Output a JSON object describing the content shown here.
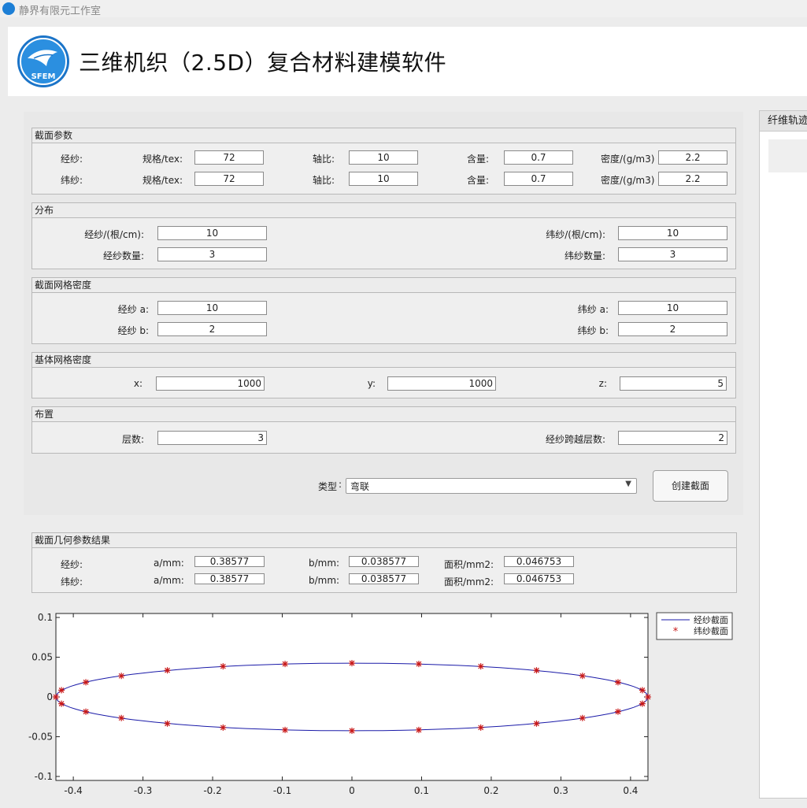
{
  "window": {
    "title": "静界有限元工作室"
  },
  "app": {
    "title": "三维机织（2.5D）复合材料建模软件",
    "logo_text": "SFEM"
  },
  "colors": {
    "accent": "#1d7fd6",
    "warp_line": "#1a1aa8",
    "weft_marker": "#c81818"
  },
  "section_params": {
    "title": "截面参数",
    "rows": [
      {
        "label": "经纱:",
        "spec_label": "规格/tex:",
        "spec": "72",
        "ratio_label": "轴比:",
        "ratio": "10",
        "content_label": "含量:",
        "content": "0.7",
        "density_label": "密度/(g/m3)",
        "density": "2.2"
      },
      {
        "label": "纬纱:",
        "spec_label": "规格/tex:",
        "spec": "72",
        "ratio_label": "轴比:",
        "ratio": "10",
        "content_label": "含量:",
        "content": "0.7",
        "density_label": "密度/(g/m3)",
        "density": "2.2"
      }
    ]
  },
  "distribution": {
    "title": "分布",
    "warp_density_label": "经纱/(根/cm):",
    "warp_density": "10",
    "weft_density_label": "纬纱/(根/cm):",
    "weft_density": "10",
    "warp_count_label": "经纱数量:",
    "warp_count": "3",
    "weft_count_label": "纬纱数量:",
    "weft_count": "3"
  },
  "section_mesh": {
    "title": "截面网格密度",
    "warp_a_label": "经纱 a:",
    "warp_a": "10",
    "warp_b_label": "经纱 b:",
    "warp_b": "2",
    "weft_a_label": "纬纱 a:",
    "weft_a": "10",
    "weft_b_label": "纬纱 b:",
    "weft_b": "2"
  },
  "matrix_mesh": {
    "title": "基体网格密度",
    "x_label": "x:",
    "x": "1000",
    "y_label": "y:",
    "y": "1000",
    "z_label": "z:",
    "z": "5"
  },
  "layout": {
    "title": "布置",
    "layers_label": "层数:",
    "layers": "3",
    "span_label": "经纱跨越层数:",
    "span": "2"
  },
  "type_select": {
    "label": "类型",
    "value": "弯联"
  },
  "create_button": "创建截面",
  "right_panel": {
    "title": "纤维轨迹"
  },
  "results": {
    "title": "截面几何参数结果",
    "rows": [
      {
        "label": "经纱:",
        "a_label": "a/mm:",
        "a": "0.38577",
        "b_label": "b/mm:",
        "b": "0.038577",
        "area_label": "面积/mm2:",
        "area": "0.046753"
      },
      {
        "label": "纬纱:",
        "a_label": "a/mm:",
        "a": "0.38577",
        "b_label": "b/mm:",
        "b": "0.038577",
        "area_label": "面积/mm2:",
        "area": "0.046753"
      }
    ]
  },
  "chart_data": {
    "type": "line",
    "xlim": [
      -0.425,
      0.425
    ],
    "ylim": [
      -0.105,
      0.105
    ],
    "xticks": [
      -0.4,
      -0.3,
      -0.2,
      -0.1,
      0,
      0.1,
      0.2,
      0.3,
      0.4
    ],
    "xtick_labels": [
      "-0.4",
      "-0.3",
      "-0.2",
      "-0.1",
      "0",
      "0.1",
      "0.2",
      "0.3",
      "0.4"
    ],
    "yticks": [
      0.1,
      0.05,
      0,
      -0.05,
      -0.1
    ],
    "ytick_labels": [
      "0.1",
      "0.05",
      "0",
      "-0.05",
      "-0.1"
    ],
    "legend": {
      "placement": "top-right, outside plot",
      "entries": [
        "经纱截面",
        "纬纱截面"
      ]
    },
    "series": [
      {
        "name": "经纱截面",
        "style": "line",
        "ellipse": {
          "a": 0.425,
          "b": 0.0425
        }
      },
      {
        "name": "纬纱截面",
        "style": "asterisk",
        "x": [
          -0.425,
          -0.417,
          -0.382,
          -0.331,
          -0.265,
          -0.185,
          -0.096,
          0,
          0.096,
          0.185,
          0.265,
          0.331,
          0.382,
          0.417,
          0.425,
          0.417,
          0.382,
          0.331,
          0.265,
          0.185,
          0.096,
          0,
          -0.096,
          -0.185,
          -0.265,
          -0.331,
          -0.382,
          -0.417
        ],
        "y": [
          0,
          0.0085,
          0.0185,
          0.0265,
          0.0335,
          0.0385,
          0.0415,
          0.0425,
          0.0415,
          0.0385,
          0.0335,
          0.0265,
          0.0185,
          0.0085,
          0,
          -0.0085,
          -0.0185,
          -0.0265,
          -0.0335,
          -0.0385,
          -0.0415,
          -0.0425,
          -0.0415,
          -0.0385,
          -0.0335,
          -0.0265,
          -0.0185,
          -0.0085
        ]
      }
    ]
  }
}
